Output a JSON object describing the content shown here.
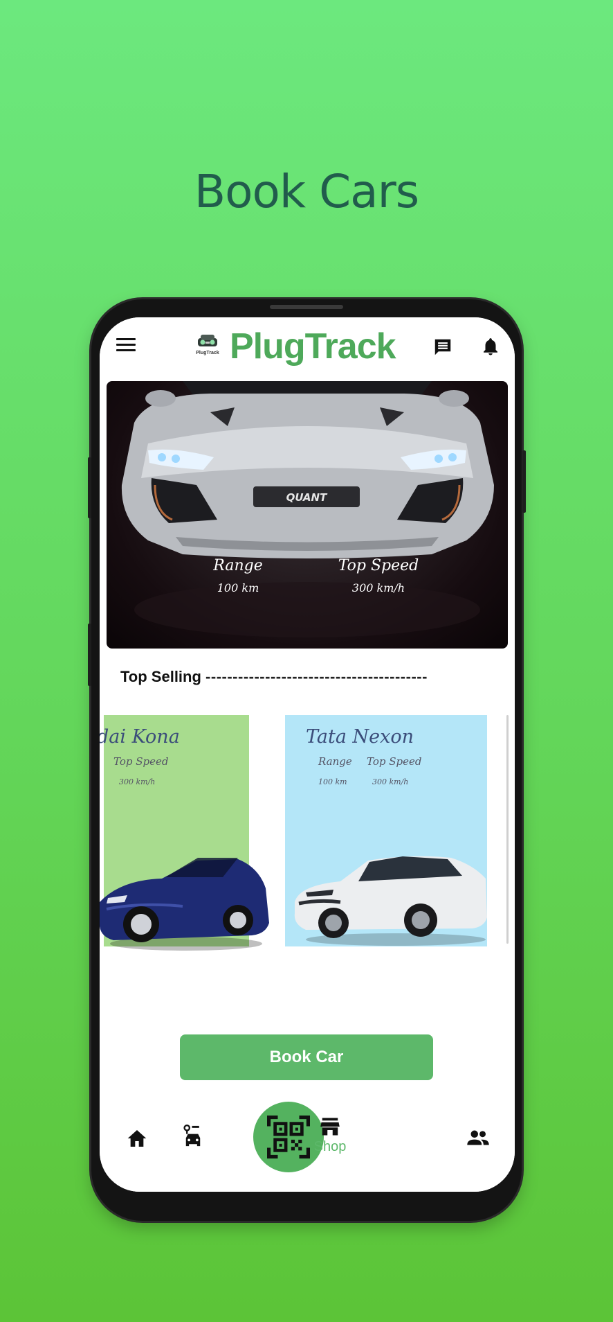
{
  "headline": "Book Cars",
  "app": {
    "brand": "PlugTrack",
    "logo_text": "PlugTrack"
  },
  "hero": {
    "car_badge": "QUANT",
    "range_label": "Range",
    "range_value": "100 km",
    "speed_label": "Top Speed",
    "speed_value": "300 km/h"
  },
  "section": {
    "title": "Top Selling",
    "dashes": "-----------------------------------------"
  },
  "cards": [
    {
      "name": "dai Kona",
      "speed_label": "Top Speed",
      "speed_value": "300 km/h",
      "bg": "#a8dc8e"
    },
    {
      "name": "Tata Nexon",
      "range_label": "Range",
      "range_value": "100 km",
      "speed_label": "Top Speed",
      "speed_value": "300 km/h",
      "bg": "#b4e6f8"
    }
  ],
  "actions": {
    "book_label": "Book Car"
  },
  "nav": {
    "shop_label": "Shop"
  },
  "colors": {
    "accent": "#5db86a",
    "brand_text": "#4ea95a",
    "headline": "#215c4c",
    "background_top": "#6ce87e",
    "background_bottom": "#5cc437"
  }
}
